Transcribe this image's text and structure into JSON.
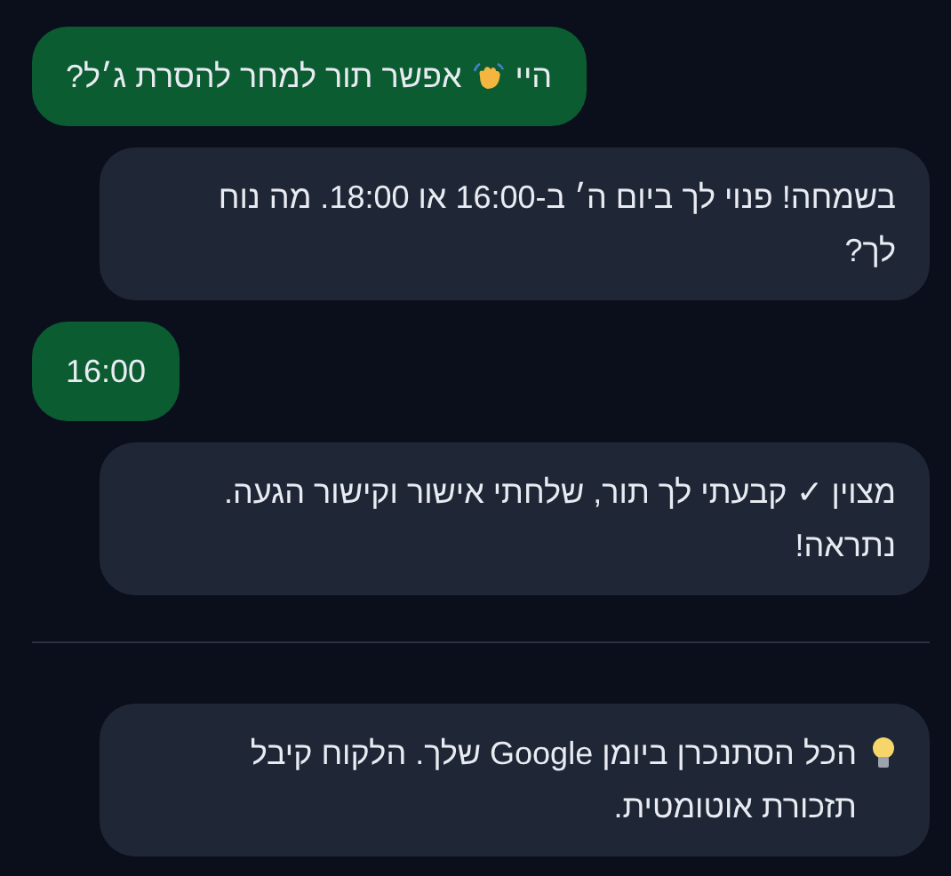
{
  "messages": [
    {
      "kind": "sent",
      "parts": [
        {
          "kind": "text",
          "text": "היי"
        },
        {
          "kind": "wave_emoji"
        },
        {
          "kind": "text",
          "text": "אפשר תור למחר להסרת ג׳ל?"
        }
      ]
    },
    {
      "kind": "received",
      "parts": [
        {
          "kind": "text",
          "text": "בשמחה! פנוי לך ביום ה׳ ב-16:00 או 18:00. מה נוח לך?"
        }
      ]
    },
    {
      "kind": "sent",
      "parts": [
        {
          "kind": "text",
          "text": "16:00"
        }
      ]
    },
    {
      "kind": "received",
      "parts": [
        {
          "kind": "text",
          "text": "מצוין ✓ קבעתי לך תור, שלחתי אישור וקישור הגעה. נתראה!"
        }
      ]
    },
    {
      "kind": "divider"
    },
    {
      "kind": "received",
      "parts": [
        {
          "kind": "bulb_emoji"
        },
        {
          "kind": "text",
          "text": "הכל הסתנכרן ביומן Google שלך. הלקוח קיבל תזכורת אוטומטית."
        }
      ]
    }
  ]
}
